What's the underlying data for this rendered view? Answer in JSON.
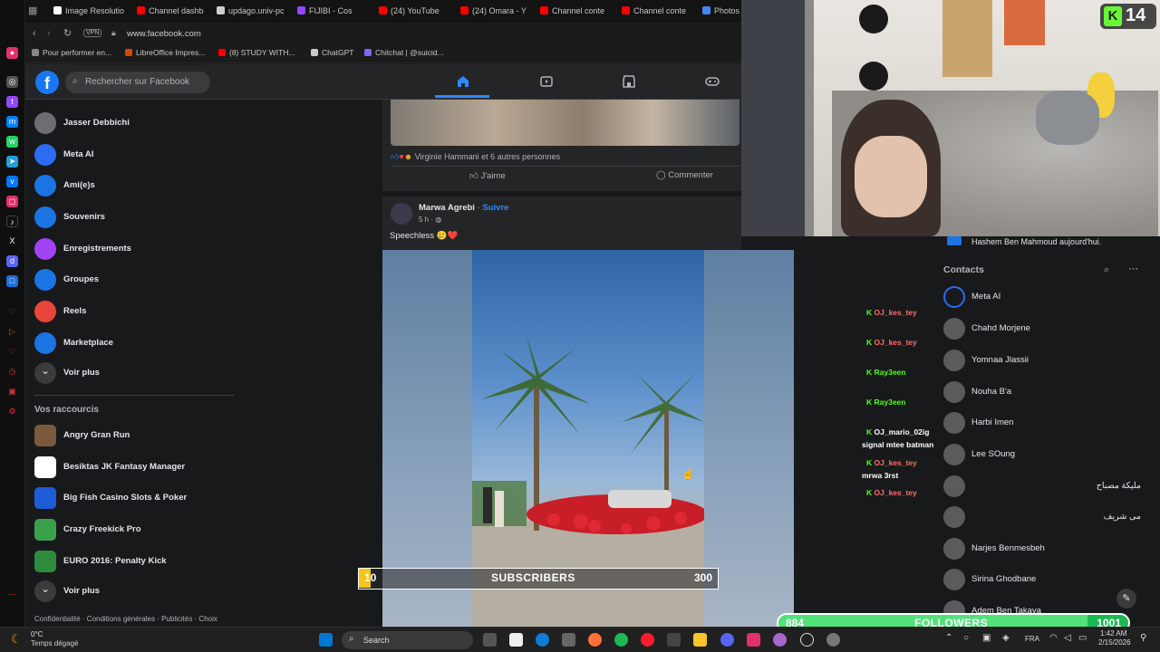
{
  "browser": {
    "tabs": [
      {
        "label": "Image Resolutio",
        "color": "#ffffff"
      },
      {
        "label": "Channel dashb",
        "color": "#ff0000"
      },
      {
        "label": "updago.univ-pc",
        "color": "#cccccc"
      },
      {
        "label": "FIJIBI - Cos",
        "color": "#9146ff"
      },
      {
        "label": "(24) YouTube",
        "color": "#ff0000"
      },
      {
        "label": "(24) Omara - Y",
        "color": "#ff0000"
      },
      {
        "label": "Channel conte",
        "color": "#ff0000"
      },
      {
        "label": "Channel conte",
        "color": "#ff0000"
      },
      {
        "label": "Photos",
        "color": "#4285f4"
      }
    ],
    "vpn_label": "VPN",
    "url": "www.facebook.com",
    "bookmarks": [
      {
        "label": "Pour performer en...",
        "color": "#888888"
      },
      {
        "label": "LibreOffice Impres...",
        "color": "#d04a02"
      },
      {
        "label": "(8) STUDY WITH...",
        "color": "#ff0000"
      },
      {
        "label": "ChatGPT",
        "color": "#cccccc"
      },
      {
        "label": "Chitchat | @suicid...",
        "color": "#7b68ee"
      }
    ]
  },
  "facebook": {
    "logo": "f",
    "search_placeholder": "Rechercher sur Facebook",
    "sidebar": [
      {
        "label": "Jasser Debbichi",
        "icon": "avatar-icon",
        "color": "#6b6f74"
      },
      {
        "label": "Meta AI",
        "icon": "meta-ai-icon",
        "color": "#2d6bf2"
      },
      {
        "label": "Ami(e)s",
        "icon": "friends-icon",
        "color": "#1b74e4"
      },
      {
        "label": "Souvenirs",
        "icon": "clock-icon",
        "color": "#1b74e4"
      },
      {
        "label": "Enregistrements",
        "icon": "bookmark-icon",
        "color": "#a142f4"
      },
      {
        "label": "Groupes",
        "icon": "groups-icon",
        "color": "#1b74e4"
      },
      {
        "label": "Reels",
        "icon": "reels-icon",
        "color": "#e8453c"
      },
      {
        "label": "Marketplace",
        "icon": "marketplace-icon",
        "color": "#1b74e4"
      },
      {
        "label": "Voir plus",
        "icon": "chevron-down-icon",
        "color": "#3a3b3c"
      }
    ],
    "shortcuts_title": "Vos raccourcis",
    "shortcuts": [
      {
        "label": "Angry Gran Run",
        "color": "#7a5a3c"
      },
      {
        "label": "Besiktas JK Fantasy Manager",
        "color": "#ffffff"
      },
      {
        "label": "Big Fish Casino Slots & Poker",
        "color": "#1e5bd6"
      },
      {
        "label": "Crazy Freekick Pro",
        "color": "#3aa14a"
      },
      {
        "label": "EURO 2016: Penalty Kick",
        "color": "#2e8b3e"
      },
      {
        "label": "Voir plus",
        "color": "#3a3b3c"
      }
    ],
    "footer": "Confidentialité · Conditions générales · Publicités · Choix",
    "post1": {
      "reactions": "Virginie Hammani et 6 autres personnes",
      "like": "J'aime",
      "comment": "Commenter"
    },
    "post2": {
      "author": "Marwa Agrebi",
      "follow": "Suivre",
      "time": "5 h · ",
      "text": "Speechless 🥲❤️"
    },
    "right_top_text": "Hashem Ben Mahmoud aujourd'hui.",
    "contacts_title": "Contacts",
    "contacts": [
      {
        "name": "Meta AI",
        "align": "left"
      },
      {
        "name": "Chahd Morjene",
        "align": "left"
      },
      {
        "name": "Yomnaa Jlassii",
        "align": "left"
      },
      {
        "name": "Nouha B'a",
        "align": "left"
      },
      {
        "name": "Harbi Imen",
        "align": "left"
      },
      {
        "name": "Lee SOung",
        "align": "left"
      },
      {
        "name": "مليكة مصباح",
        "align": "right"
      },
      {
        "name": "مى شريف",
        "align": "right"
      },
      {
        "name": "Narjes Benmesbeh",
        "align": "left"
      },
      {
        "name": "Sirina Ghodbane",
        "align": "left"
      },
      {
        "name": "Adem Ben Takaya",
        "align": "left"
      }
    ]
  },
  "stream_chat": [
    {
      "user": "OJ_kes_tey",
      "msg": "",
      "color": "#ff6b6b"
    },
    {
      "user": "OJ_kes_tey",
      "msg": "",
      "color": "#ff6b6b"
    },
    {
      "user": "Ray3een",
      "msg": "",
      "color": "#53fc18"
    },
    {
      "user": "Ray3een",
      "msg": "",
      "color": "#53fc18"
    },
    {
      "user": "OJ_mario_02ig",
      "msg": "signal mtee batman",
      "color": "#ffffff"
    },
    {
      "user": "OJ_kes_tey",
      "msg": "mrwa 3rst",
      "color": "#ff6b6b"
    },
    {
      "user": "OJ_kes_tey",
      "msg": "",
      "color": "#ff6b6b"
    }
  ],
  "overlay": {
    "kick_count": "14",
    "subs_current": "10",
    "subs_label": "SUBSCRIBERS",
    "subs_goal": "300",
    "subs_progress": 0.033,
    "followers_current": "884",
    "followers_label": "FOLLOWERS",
    "followers_goal": "1001",
    "followers_progress": 0.883
  },
  "taskbar": {
    "weather_temp": "0°C",
    "weather_desc": "Temps dégagé",
    "search": "Search",
    "lang": "FRA",
    "time": "1:42 AM",
    "date": "2/15/2026"
  }
}
